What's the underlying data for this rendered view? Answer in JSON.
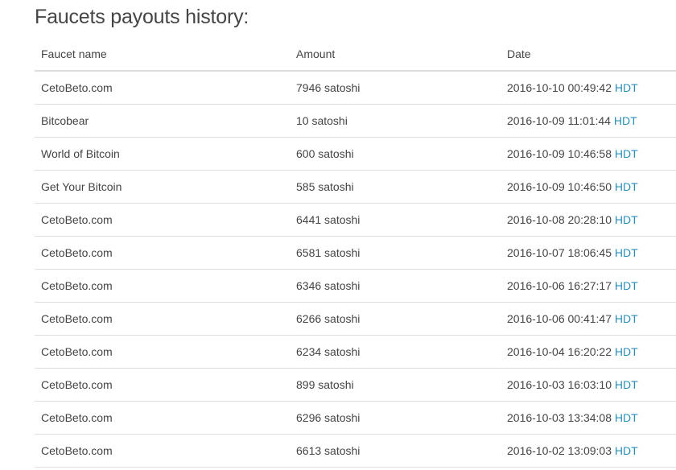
{
  "page": {
    "title": "Faucets payouts history:"
  },
  "table": {
    "headers": {
      "faucet_name": "Faucet name",
      "amount": "Amount",
      "date": "Date"
    },
    "rows": [
      {
        "faucet": "CetoBeto.com",
        "amount": "7946 satoshi",
        "date": "2016-10-10 00:49:42",
        "tz": "HDT"
      },
      {
        "faucet": "Bitcobear",
        "amount": "10 satoshi",
        "date": "2016-10-09 11:01:44",
        "tz": "HDT"
      },
      {
        "faucet": "World of Bitcoin",
        "amount": "600 satoshi",
        "date": "2016-10-09 10:46:58",
        "tz": "HDT"
      },
      {
        "faucet": "Get Your Bitcoin",
        "amount": "585 satoshi",
        "date": "2016-10-09 10:46:50",
        "tz": "HDT"
      },
      {
        "faucet": "CetoBeto.com",
        "amount": "6441 satoshi",
        "date": "2016-10-08 20:28:10",
        "tz": "HDT"
      },
      {
        "faucet": "CetoBeto.com",
        "amount": "6581 satoshi",
        "date": "2016-10-07 18:06:45",
        "tz": "HDT"
      },
      {
        "faucet": "CetoBeto.com",
        "amount": "6346 satoshi",
        "date": "2016-10-06 16:27:17",
        "tz": "HDT"
      },
      {
        "faucet": "CetoBeto.com",
        "amount": "6266 satoshi",
        "date": "2016-10-06 00:41:47",
        "tz": "HDT"
      },
      {
        "faucet": "CetoBeto.com",
        "amount": "6234 satoshi",
        "date": "2016-10-04 16:20:22",
        "tz": "HDT"
      },
      {
        "faucet": "CetoBeto.com",
        "amount": "899 satoshi",
        "date": "2016-10-03 16:03:10",
        "tz": "HDT"
      },
      {
        "faucet": "CetoBeto.com",
        "amount": "6296 satoshi",
        "date": "2016-10-03 13:34:08",
        "tz": "HDT"
      },
      {
        "faucet": "CetoBeto.com",
        "amount": "6613 satoshi",
        "date": "2016-10-02 13:09:03",
        "tz": "HDT"
      }
    ]
  },
  "colors": {
    "text": "#444444",
    "timezone_link": "#2a8fb8",
    "row_border": "#dddddd"
  }
}
